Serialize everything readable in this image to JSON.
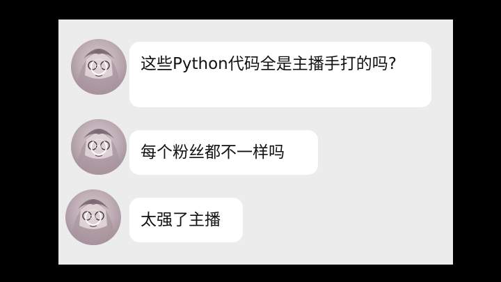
{
  "messages": [
    {
      "text": "这些Python代码全是主播手打的吗?",
      "loading": "0%"
    },
    {
      "text": "每个粉丝都不一样吗",
      "loading": "0%"
    },
    {
      "text": "太强了主播",
      "loading": "0%"
    }
  ],
  "colors": {
    "outer_background": "#000000",
    "chat_background": "#ececec",
    "bubble_background": "#ffffff",
    "text": "#111111"
  }
}
